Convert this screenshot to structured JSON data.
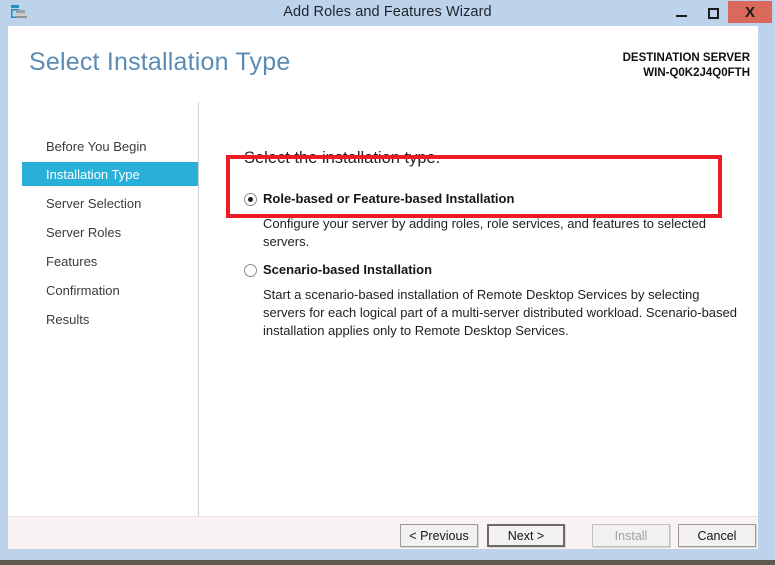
{
  "window": {
    "title": "Add Roles and Features Wizard",
    "icon": "server-roles-icon",
    "controls": {
      "minimize": "–",
      "maximize": "□",
      "close": "X"
    }
  },
  "header": {
    "page_title": "Select Installation Type",
    "destination_label": "DESTINATION SERVER",
    "destination_server": "WIN-Q0K2J4Q0FTH"
  },
  "sidebar": {
    "items": [
      {
        "label": "Before You Begin",
        "selected": false
      },
      {
        "label": "Installation Type",
        "selected": true
      },
      {
        "label": "Server Selection",
        "selected": false
      },
      {
        "label": "Server Roles",
        "selected": false
      },
      {
        "label": "Features",
        "selected": false
      },
      {
        "label": "Confirmation",
        "selected": false
      },
      {
        "label": "Results",
        "selected": false
      }
    ]
  },
  "content": {
    "heading": "Select the installation type.",
    "options": [
      {
        "label": "Role-based or Feature-based Installation",
        "description": "Configure your server by adding roles, role services, and features to selected servers.",
        "selected": true
      },
      {
        "label": "Scenario-based Installation",
        "description": "Start a scenario-based installation of Remote Desktop Services by selecting servers for each logical part of a multi-server distributed workload. Scenario-based installation applies only to Remote Desktop Services.",
        "selected": false
      }
    ]
  },
  "annotation": {
    "color": "#ed1c24",
    "target": "Role-based or Feature-based Installation"
  },
  "footer": {
    "buttons": [
      {
        "label": "< Previous",
        "state": "enabled"
      },
      {
        "label": "Next >",
        "state": "default"
      },
      {
        "label": "Install",
        "state": "disabled"
      },
      {
        "label": "Cancel",
        "state": "enabled"
      }
    ]
  },
  "colors": {
    "accent_selected": "#29b0d8",
    "title_text": "#5b8bb5",
    "window_chrome": "#bdd3ec",
    "close_button": "#d9695b",
    "annotation": "#ed1c24"
  }
}
